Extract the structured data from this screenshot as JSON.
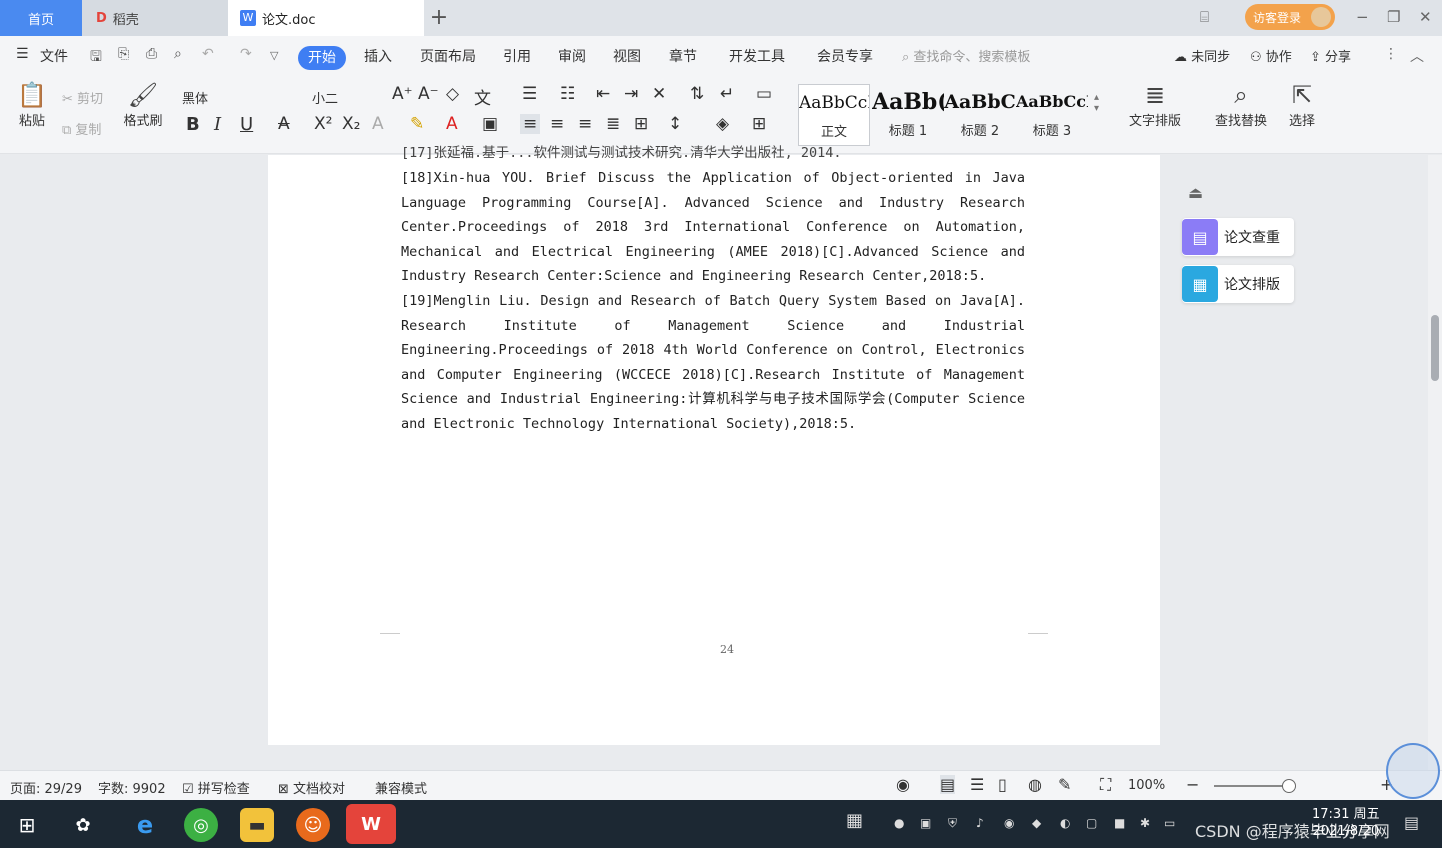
{
  "tabs": {
    "home": "首页",
    "drafts": "稻壳",
    "doc": "论文.doc",
    "add": "+"
  },
  "titlebar": {
    "login": "访客登录",
    "minimize": "−",
    "restore": "❐",
    "close": "✕"
  },
  "menu": {
    "file": "文件",
    "start": "开始",
    "insert": "插入",
    "layout": "页面布局",
    "references": "引用",
    "review": "审阅",
    "view": "视图",
    "section": "章节",
    "devtools": "开发工具",
    "member": "会员专享",
    "search": "查找命令、搜索模板",
    "unsync": "未同步",
    "collab": "协作",
    "share": "分享"
  },
  "ribbon": {
    "paste": "粘贴",
    "cut": "剪切",
    "copy": "复制",
    "format_painter": "格式刷",
    "font_name": "黑体",
    "font_size": "小二",
    "styles": [
      {
        "sample": "AaBbCcI",
        "name": "正文"
      },
      {
        "sample": "AaBb(",
        "name": "标题 1"
      },
      {
        "sample": "AaBbC",
        "name": "标题 2"
      },
      {
        "sample": "AaBbCcI",
        "name": "标题 3"
      }
    ],
    "text_layout": "文字排版",
    "find_replace": "查找替换",
    "select": "选择"
  },
  "document": {
    "ref_top_partial": "[17]张延福.基于...软件测试与测试技术研究.清华大学出版社, 2014.",
    "ref18": "[18]Xin-hua YOU. Brief Discuss the Application of Object-oriented in Java Language Programming Course[A]. Advanced Science and Industry Research Center.Proceedings of 2018 3rd International Conference on Automation, Mechanical and Electrical Engineering (AMEE 2018)[C].Advanced Science and Industry Research Center:Science and Engineering Research Center,2018:5.",
    "ref19": "[19]Menglin Liu. Design and Research of Batch Query System Based on Java[A]. Research Institute of Management Science and Industrial Engineering.Proceedings of 2018 4th World Conference on Control, Electronics and Computer Engineering (WCCECE 2018)[C].Research Institute of Management Science and Industrial Engineering:计算机科学与电子技术国际学会(Computer Science and Electronic Technology International Society),2018:5.",
    "page_number": "24"
  },
  "side_panel": {
    "check": "论文查重",
    "format": "论文排版"
  },
  "status": {
    "page": "页面: 29/29",
    "words": "字数: 9902",
    "spell": "拼写检查",
    "proof": "文档校对",
    "compat": "兼容模式",
    "zoom": "100%"
  },
  "taskbar": {
    "time": "17:31 周五",
    "date": "2021/8/20",
    "watermark": "CSDN @程序猿毕业分享网"
  },
  "colors": {
    "accent": "#3f7ef3",
    "login": "#f3a24b",
    "check_icon": "#8b7cf6",
    "format_icon": "#2aa8e0"
  }
}
